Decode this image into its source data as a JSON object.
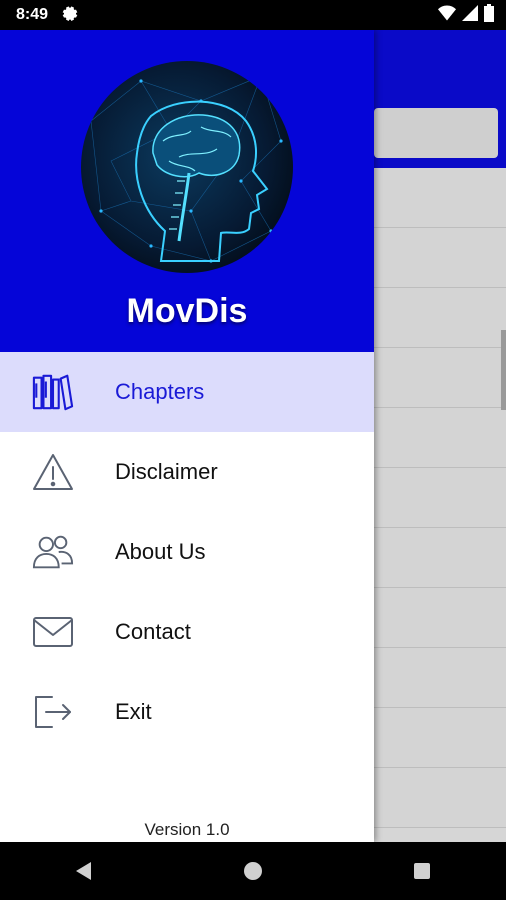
{
  "status_bar": {
    "time": "8:49"
  },
  "drawer": {
    "app_name": "MovDis",
    "items": [
      {
        "label": "Chapters",
        "icon": "books-icon",
        "active": true
      },
      {
        "label": "Disclaimer",
        "icon": "warning-icon",
        "active": false
      },
      {
        "label": "About Us",
        "icon": "users-icon",
        "active": false
      },
      {
        "label": "Contact",
        "icon": "mail-icon",
        "active": false
      },
      {
        "label": "Exit",
        "icon": "exit-icon",
        "active": false
      }
    ],
    "version": "Version 1.0"
  },
  "colors": {
    "header_blue": "#0505d8",
    "active_bg": "#dcdcfc",
    "active_text": "#1a1ad6"
  }
}
